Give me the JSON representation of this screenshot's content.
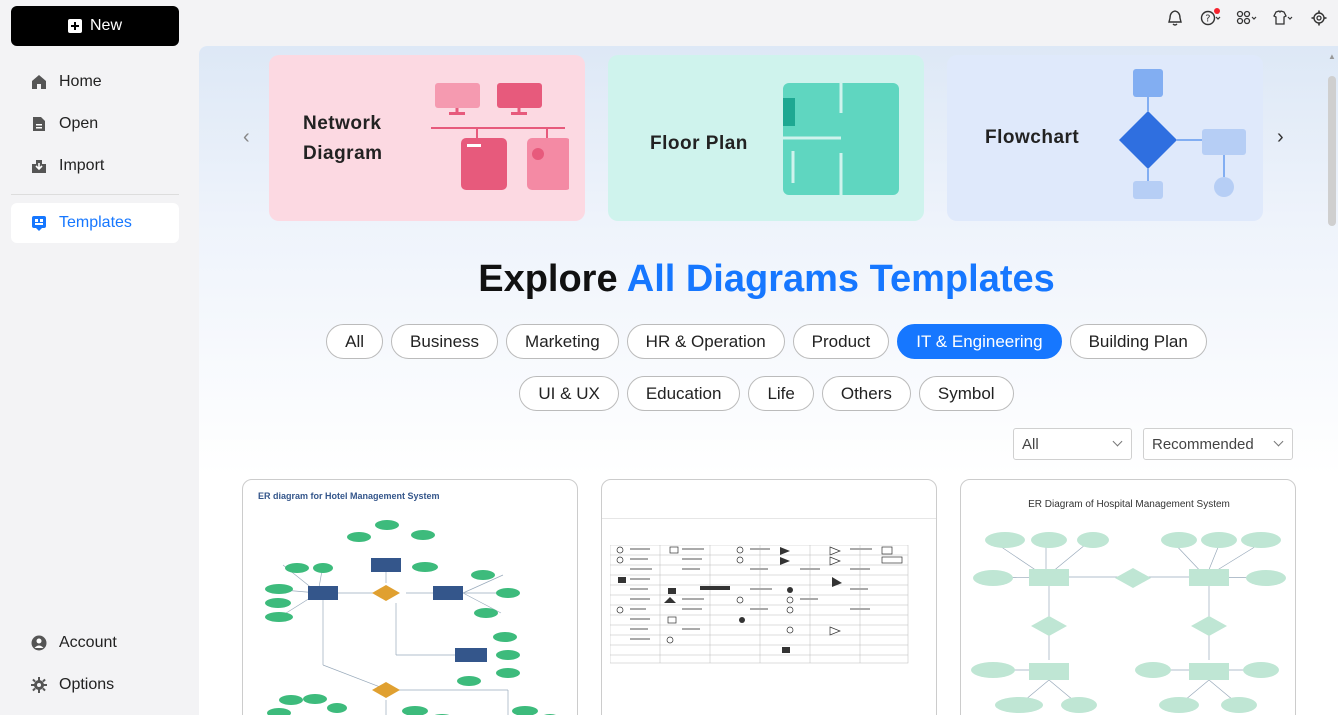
{
  "sidebar": {
    "new_label": "New",
    "items": [
      {
        "label": "Home",
        "icon": "home-icon"
      },
      {
        "label": "Open",
        "icon": "file-icon"
      },
      {
        "label": "Import",
        "icon": "import-icon"
      },
      {
        "label": "Templates",
        "icon": "templates-icon"
      }
    ],
    "bottom_items": [
      {
        "label": "Account",
        "icon": "account-icon"
      },
      {
        "label": "Options",
        "icon": "gear-icon"
      }
    ]
  },
  "banners": [
    {
      "title_line1": "Network",
      "title_line2": "Diagram"
    },
    {
      "title_line1": "Floor  Plan"
    },
    {
      "title_line1": "Flowchart"
    }
  ],
  "heading": {
    "part1": "Explore ",
    "part2": "All Diagrams Templates"
  },
  "categories_row1": [
    "All",
    "Business",
    "Marketing",
    "HR & Operation",
    "Product",
    "IT & Engineering",
    "Building Plan"
  ],
  "categories_row2": [
    "UI & UX",
    "Education",
    "Life",
    "Others",
    "Symbol"
  ],
  "active_category": "IT & Engineering",
  "filters": {
    "type_selected": "All",
    "sort_selected": "Recommended"
  },
  "templates": [
    {
      "title": "ER diagram for Hotel Management System"
    },
    {
      "title": ""
    },
    {
      "title": "ER Diagram of Hospital Management System"
    }
  ],
  "colors": {
    "accent": "#1677ff",
    "er_entity": "#34568b",
    "er_attr": "#3dbb7c",
    "er_relation": "#e0a030",
    "hosp_green": "#bfe6d4"
  }
}
